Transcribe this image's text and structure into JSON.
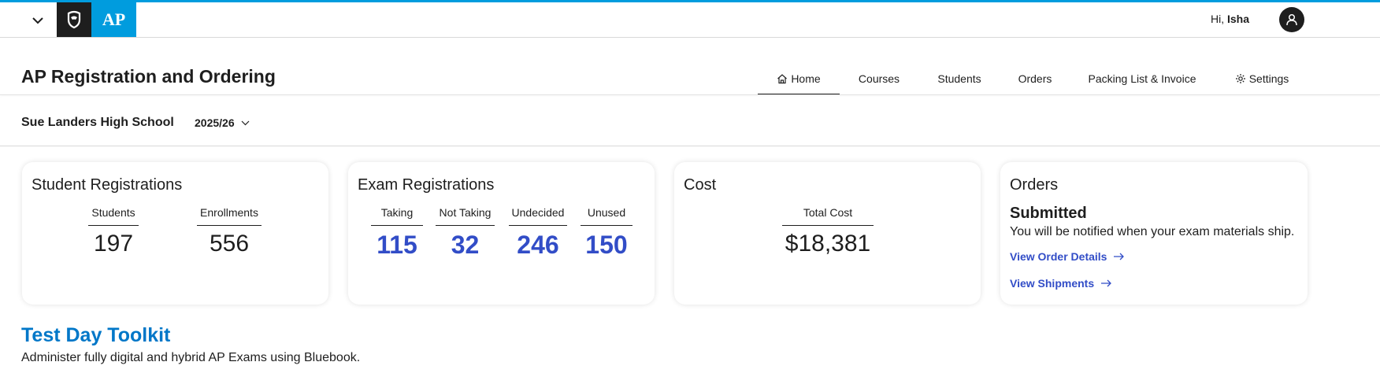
{
  "header": {
    "greeting": "Hi,",
    "user_name": "Isha",
    "logo_text": "AP"
  },
  "page": {
    "title": "AP Registration and Ordering"
  },
  "nav": {
    "items": [
      {
        "label": "Home",
        "icon": "home-icon"
      },
      {
        "label": "Courses"
      },
      {
        "label": "Students"
      },
      {
        "label": "Orders"
      },
      {
        "label": "Packing List & Invoice"
      },
      {
        "label": "Settings",
        "icon": "gear-icon"
      }
    ],
    "active": "Home"
  },
  "school": {
    "name": "Sue Landers High School",
    "year": "2025/26"
  },
  "cards": {
    "student_registrations": {
      "title": "Student Registrations",
      "stats": [
        {
          "label": "Students",
          "value": "197"
        },
        {
          "label": "Enrollments",
          "value": "556"
        }
      ]
    },
    "exam_registrations": {
      "title": "Exam Registrations",
      "stats": [
        {
          "label": "Taking",
          "value": "115"
        },
        {
          "label": "Not Taking",
          "value": "32"
        },
        {
          "label": "Undecided",
          "value": "246"
        },
        {
          "label": "Unused",
          "value": "150"
        }
      ]
    },
    "cost": {
      "title": "Cost",
      "label": "Total Cost",
      "value": "$18,381"
    },
    "orders": {
      "title": "Orders",
      "status": "Submitted",
      "message": "You will be notified when your exam materials ship.",
      "link_details": "View Order Details",
      "link_shipments": "View Shipments"
    }
  },
  "toolkit": {
    "title": "Test Day Toolkit",
    "description": "Administer fully digital and hybrid AP Exams using Bluebook."
  },
  "colors": {
    "accent_blue": "#009cde",
    "stat_blue": "#324dc7",
    "link_blue": "#0077c8"
  }
}
